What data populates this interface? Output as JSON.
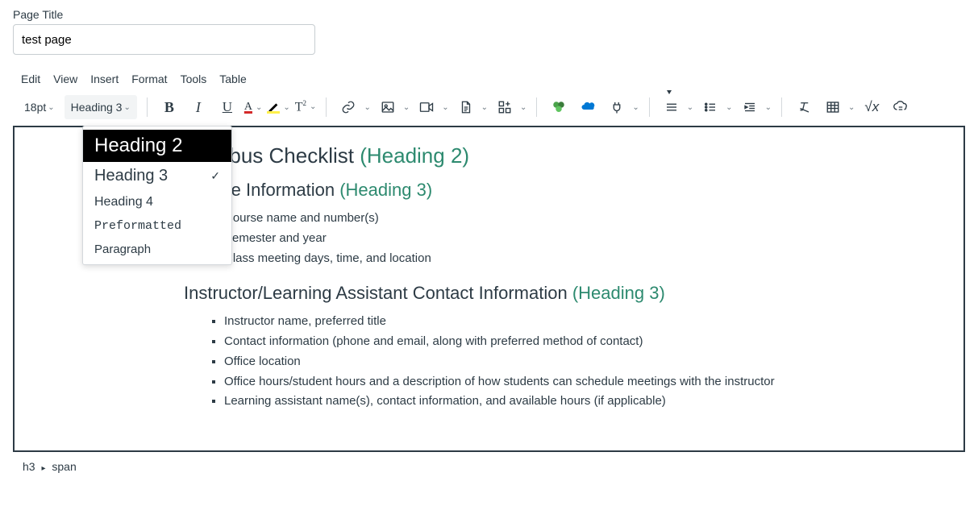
{
  "field": {
    "label": "Page Title",
    "value": "test page"
  },
  "menubar": [
    "Edit",
    "View",
    "Insert",
    "Format",
    "Tools",
    "Table"
  ],
  "toolbar": {
    "fontsize": "18pt",
    "format_selected": "Heading 3"
  },
  "format_dropdown": {
    "items": [
      {
        "label": "Heading 2",
        "class": "h2",
        "selected": false,
        "highlighted": true
      },
      {
        "label": "Heading 3",
        "class": "h3",
        "selected": true,
        "highlighted": false
      },
      {
        "label": "Heading 4",
        "class": "h4",
        "selected": false,
        "highlighted": false
      },
      {
        "label": "Preformatted",
        "class": "pre",
        "selected": false,
        "highlighted": false
      },
      {
        "label": "Paragraph",
        "class": "p",
        "selected": false,
        "highlighted": false
      }
    ]
  },
  "content": {
    "h2": {
      "text": "Syllabus Checklist",
      "annot": "(Heading 2)"
    },
    "sec1": {
      "heading": {
        "text": "Course Information",
        "annot": "(Heading 3)"
      },
      "items": [
        "Course name and number(s)",
        "Semester and year",
        "Class meeting days, time, and location"
      ]
    },
    "sec2": {
      "heading": {
        "text": "Instructor/Learning Assistant Contact Information",
        "annot": "(Heading 3)"
      },
      "items": [
        "Instructor name, preferred title",
        "Contact information (phone and email, along with preferred method of contact)",
        "Office location",
        "Office hours/student hours and a description of how students can schedule meetings with the instructor",
        "Learning assistant name(s), contact information, and available hours (if applicable)"
      ]
    }
  },
  "statusbar": {
    "path": [
      "h3",
      "span"
    ]
  },
  "colors": {
    "text_color_swatch": "#d42a2a",
    "highlight_swatch": "#fff04a",
    "heading_accent": "#2d8a6f"
  }
}
